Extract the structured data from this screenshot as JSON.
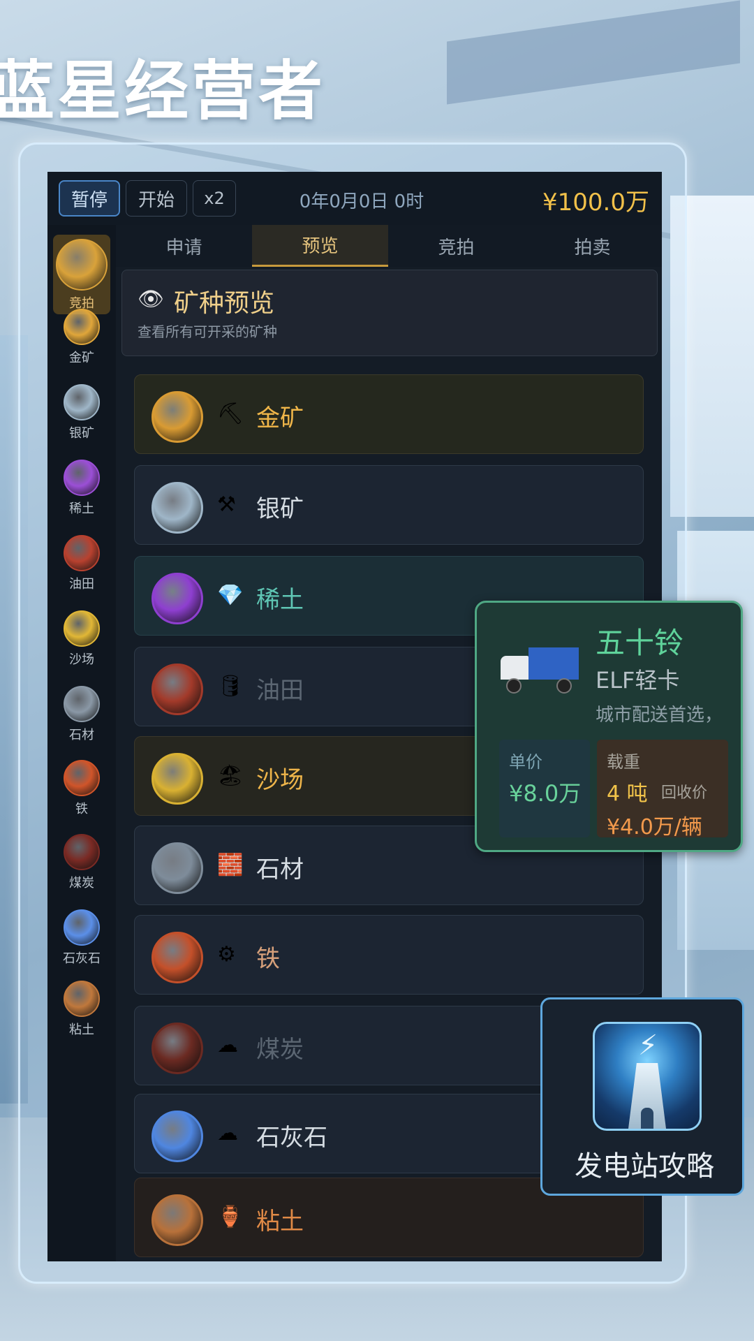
{
  "app_title": "蓝星经营者",
  "topbar": {
    "pause_label": "暂停",
    "start_label": "开始",
    "speed_label": "x2",
    "time": "0年0月0日 0时",
    "money": "¥100.0万"
  },
  "sidebar": {
    "items": [
      {
        "label": "竞拍",
        "icon": "auction-icon",
        "color": "#d9a23a",
        "active": true
      },
      {
        "label": "金矿",
        "icon": "gold-ore-icon",
        "color": "#e0a63a"
      },
      {
        "label": "银矿",
        "icon": "silver-ore-icon",
        "color": "#9fb6c8"
      },
      {
        "label": "稀土",
        "icon": "rare-earth-icon",
        "color": "#9b4fd6"
      },
      {
        "label": "油田",
        "icon": "oil-field-icon",
        "color": "#b8412f"
      },
      {
        "label": "沙场",
        "icon": "sand-field-icon",
        "color": "#e1b736"
      },
      {
        "label": "石材",
        "icon": "stone-icon",
        "color": "#8a98a6"
      },
      {
        "label": "铁",
        "icon": "iron-icon",
        "color": "#d0552a"
      },
      {
        "label": "煤炭",
        "icon": "coal-icon",
        "color": "#7a2a24"
      },
      {
        "label": "石灰石",
        "icon": "limestone-icon",
        "color": "#5b8fe8"
      },
      {
        "label": "粘土",
        "icon": "clay-icon",
        "color": "#c0783c"
      }
    ]
  },
  "tabs": [
    {
      "label": "申请"
    },
    {
      "label": "预览",
      "active": true
    },
    {
      "label": "竞拍"
    },
    {
      "label": "拍卖"
    }
  ],
  "header": {
    "title": "矿种预览",
    "subtitle": "查看所有可开采的矿种"
  },
  "minerals": [
    {
      "name": "金矿",
      "glyph": "⛏",
      "name_color": "#f0b649",
      "icon_color": "#d99b33",
      "style": "gold"
    },
    {
      "name": "银矿",
      "glyph": "⚒",
      "name_color": "#d6dde3",
      "icon_color": "#9fb6c8",
      "style": ""
    },
    {
      "name": "稀土",
      "glyph": "💎",
      "name_color": "#5fc6b4",
      "icon_color": "#8e3fd0",
      "style": "teal"
    },
    {
      "name": "油田",
      "glyph": "🛢",
      "name_color": "#5b6672",
      "icon_color": "#a33a2a",
      "style": ""
    },
    {
      "name": "沙场",
      "glyph": "🏖",
      "name_color": "#efb54a",
      "icon_color": "#d9b132",
      "style": "sand"
    },
    {
      "name": "石材",
      "glyph": "🧱",
      "name_color": "#d6dde3",
      "icon_color": "#7e8c9a",
      "style": ""
    },
    {
      "name": "铁",
      "glyph": "⚙",
      "name_color": "#d6a07a",
      "icon_color": "#c4502a",
      "style": ""
    },
    {
      "name": "煤炭",
      "glyph": "☁",
      "name_color": "#5b6672",
      "icon_color": "#6b2a22",
      "style": ""
    },
    {
      "name": "石灰石",
      "glyph": "☁",
      "name_color": "#d6dde3",
      "icon_color": "#4f86e0",
      "style": ""
    },
    {
      "name": "粘土",
      "glyph": "🏺",
      "name_color": "#e08a46",
      "icon_color": "#b8713a",
      "style": "clay"
    }
  ],
  "truck_card": {
    "name": "五十铃",
    "model": "ELF轻卡",
    "description": "城市配送首选，",
    "price_label": "单价",
    "price_value": "¥8.0万",
    "load_label": "载重",
    "load_value": "4 吨",
    "recycle_label": "回收价",
    "recycle_value": "¥4.0万/辆"
  },
  "strategy_card": {
    "label": "发电站攻略"
  }
}
